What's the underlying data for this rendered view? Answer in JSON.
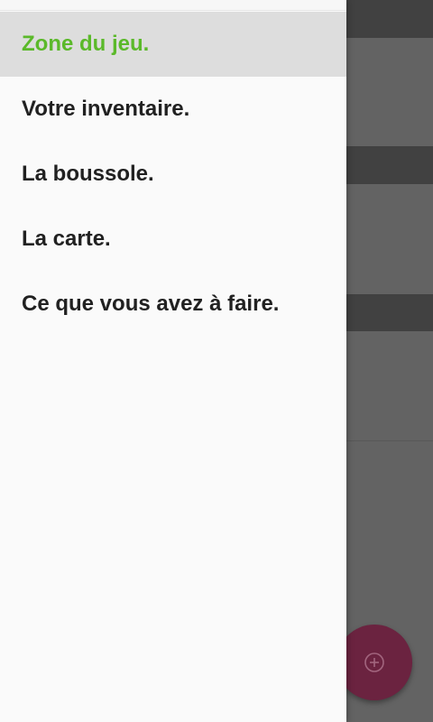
{
  "drawer": {
    "items": [
      {
        "label": "Zone du jeu.",
        "active": true
      },
      {
        "label": "Votre inventaire.",
        "active": false
      },
      {
        "label": "La boussole.",
        "active": false
      },
      {
        "label": "La carte.",
        "active": false
      },
      {
        "label": "Ce que vous avez à faire.",
        "active": false
      }
    ]
  },
  "fab": {
    "icon": "add-circle-icon"
  },
  "colors": {
    "active_item_text": "#5bb92a",
    "active_item_bg": "#dddddd",
    "drawer_bg": "#fafafa",
    "scrim": "#636363",
    "fab_bg": "#6b2340"
  }
}
